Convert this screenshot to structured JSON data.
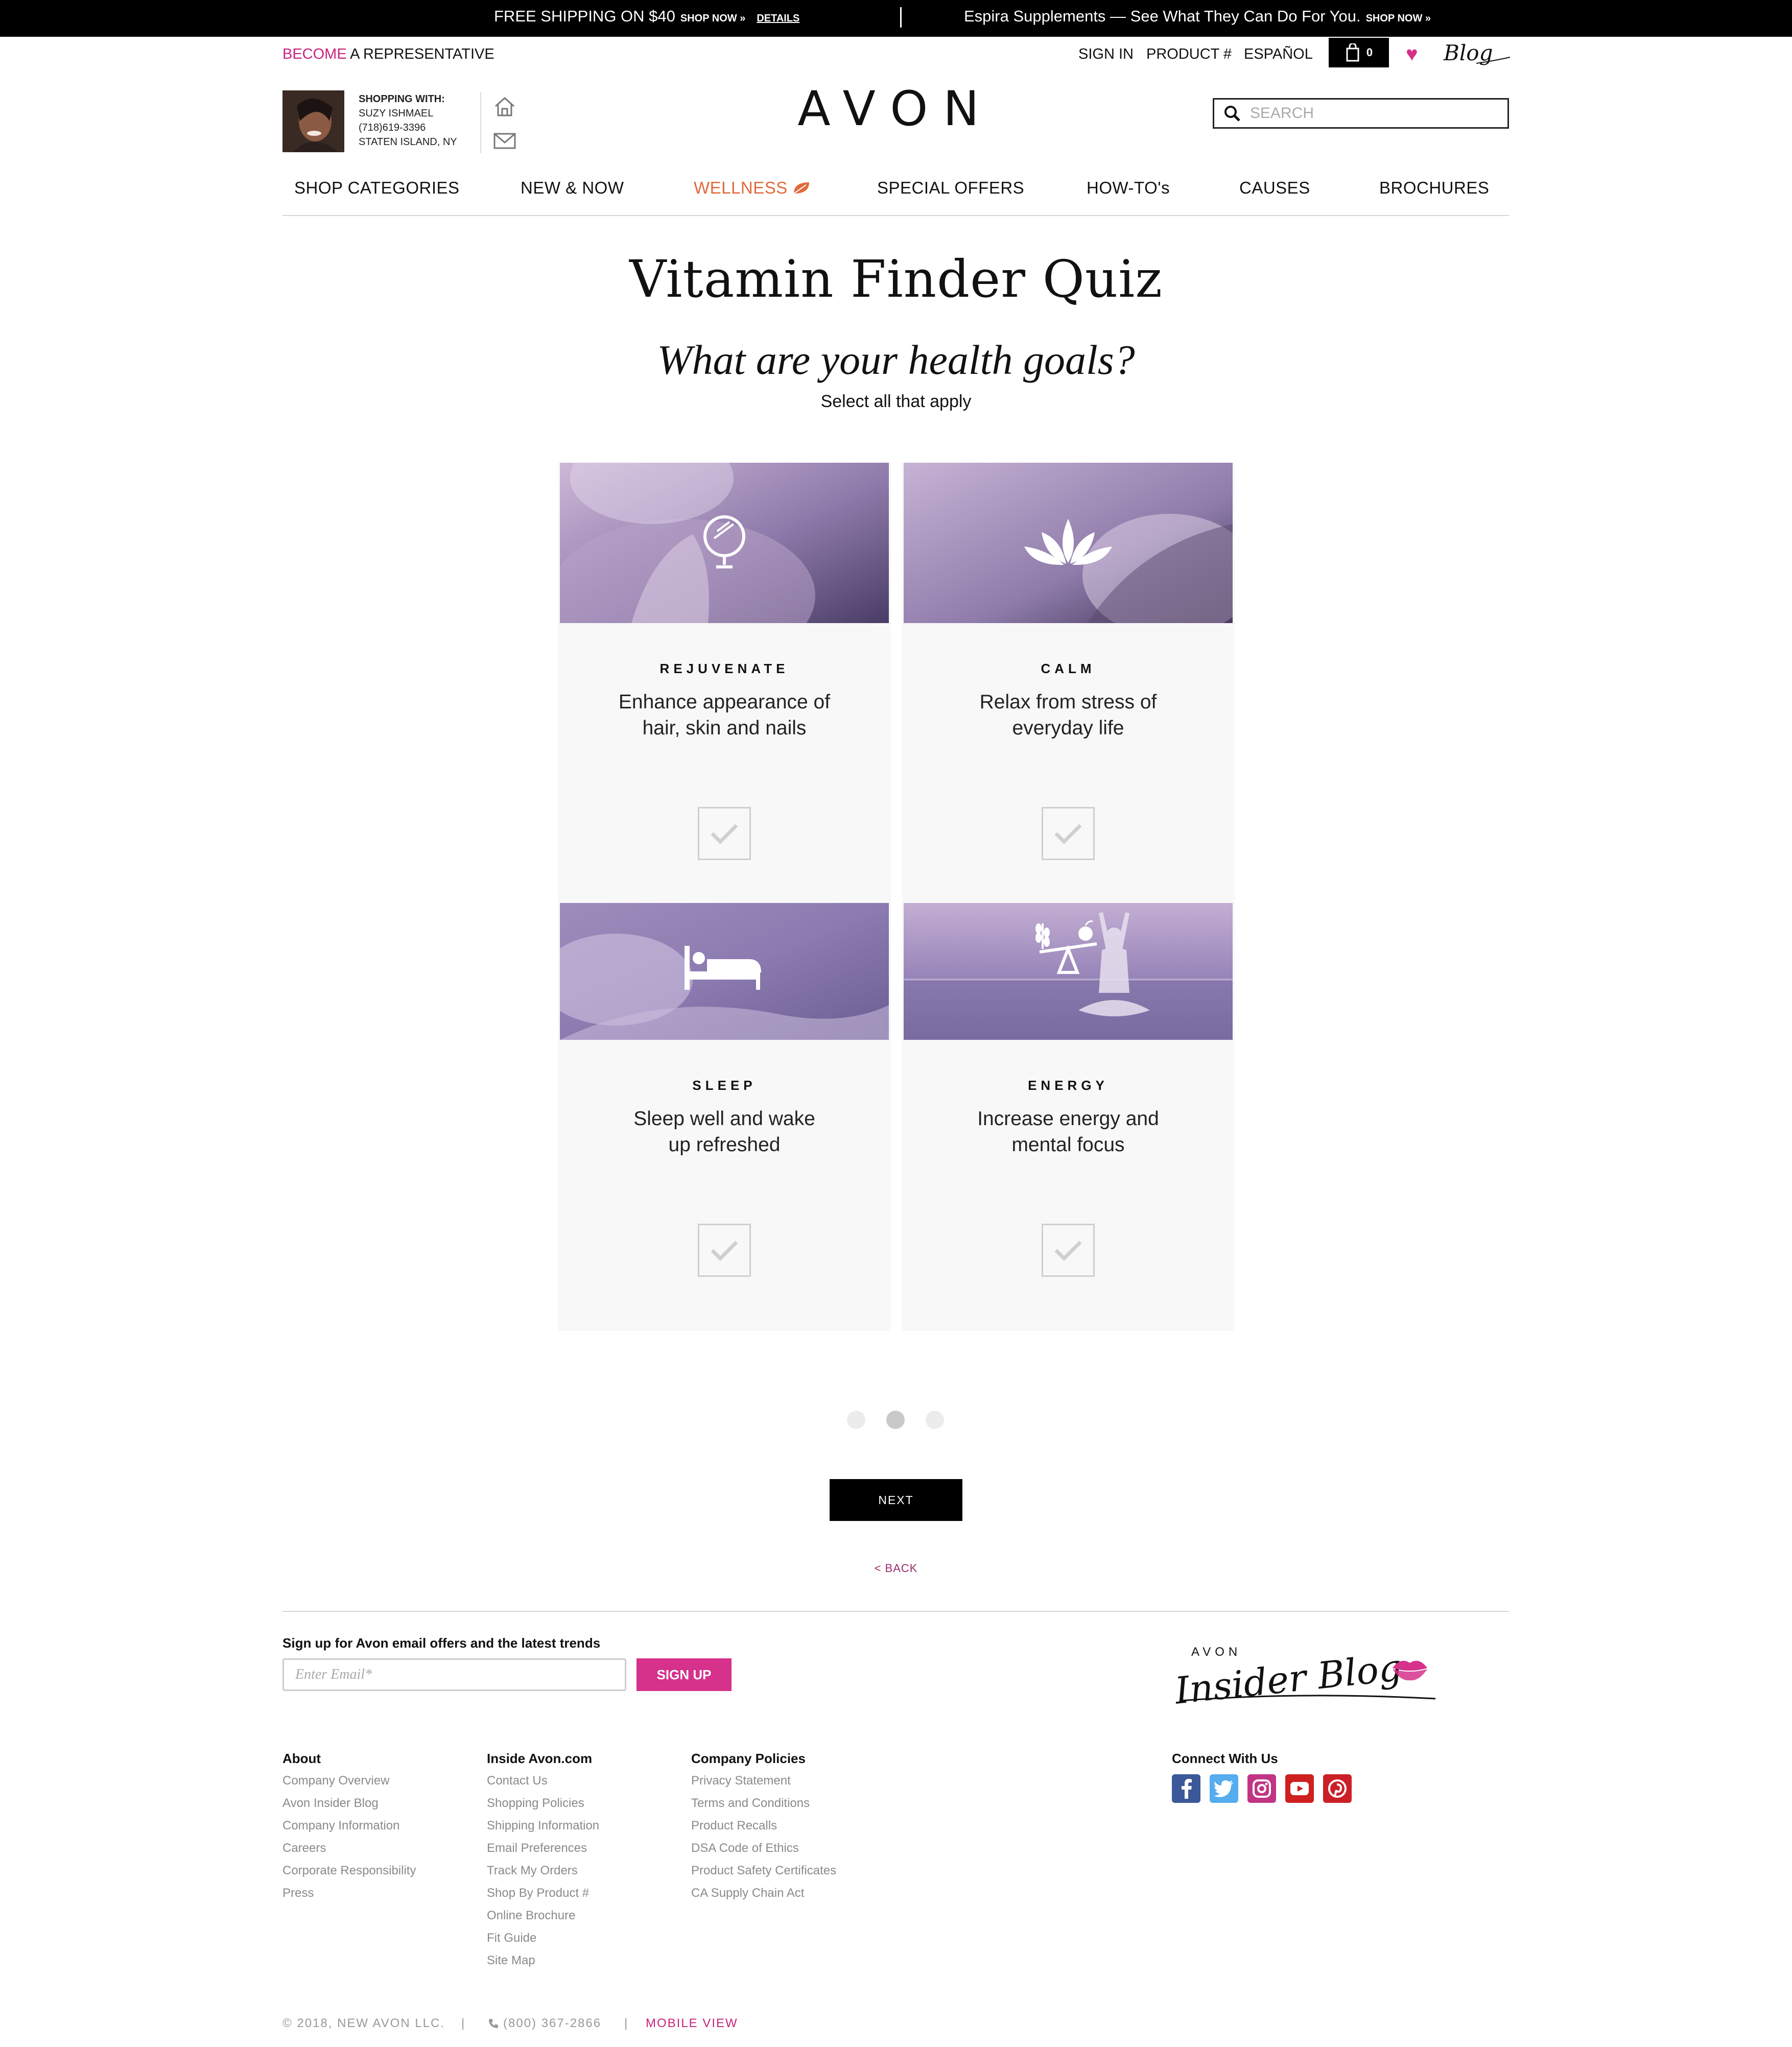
{
  "promo": {
    "left_main": "FREE SHIPPING ON $40",
    "left_cta": "SHOP NOW »",
    "left_link": "DETAILS",
    "right_main": "Espira Supplements — See What They Can Do For You.",
    "right_cta": "SHOP NOW »"
  },
  "utility": {
    "become_pink": "BECOME",
    "become_rest": " A REPRESENTATIVE",
    "sign_in": "SIGN IN",
    "product": "PRODUCT #",
    "espanol": "ESPAÑOL",
    "bag_count": "0",
    "blog": "Blog"
  },
  "rep": {
    "heading": "SHOPPING WITH:",
    "name": "SUZY ISHMAEL",
    "phone": "(718)619-3396",
    "location": "STATEN ISLAND, NY"
  },
  "brand": {
    "logo": "AVON"
  },
  "search": {
    "placeholder": "SEARCH"
  },
  "nav": {
    "items": [
      "SHOP CATEGORIES",
      "NEW & NOW",
      "WELLNESS",
      "SPECIAL OFFERS",
      "HOW-TO's",
      "CAUSES",
      "BROCHURES"
    ]
  },
  "quiz": {
    "title": "Vitamin Finder Quiz",
    "question": "What are your health goals?",
    "hint": "Select all that apply",
    "cards": [
      {
        "label": "REJUVENATE",
        "desc_line1": "Enhance appearance of",
        "desc_line2": "hair, skin and nails",
        "icon": "mirror-icon"
      },
      {
        "label": "CALM",
        "desc_line1": "Relax from stress of",
        "desc_line2": "everyday life",
        "icon": "lotus-icon"
      },
      {
        "label": "SLEEP",
        "desc_line1": "Sleep well and wake",
        "desc_line2": "up refreshed",
        "icon": "bed-icon"
      },
      {
        "label": "ENERGY",
        "desc_line1": "Increase energy and",
        "desc_line2": "mental focus",
        "icon": "balance-icon"
      }
    ],
    "pagination": {
      "pages": 3,
      "current": 2
    },
    "next": "NEXT",
    "back": "< BACK"
  },
  "footer": {
    "signup_label": "Sign up for Avon email offers and the latest trends",
    "email_placeholder": "Enter Email*",
    "signup_btn": "SIGN UP",
    "insider_top": "AVON",
    "insider_script": "Insider Blog",
    "columns": [
      {
        "title": "About",
        "links": [
          "Company Overview",
          "Avon Insider Blog",
          "Company Information",
          "Careers",
          "Corporate Responsibility",
          "Press"
        ]
      },
      {
        "title": "Inside Avon.com",
        "links": [
          "Contact Us",
          "Shopping Policies",
          "Shipping Information",
          "Email Preferences",
          "Track My Orders",
          "Shop By Product #",
          "Online Brochure",
          "Fit Guide",
          "Site Map"
        ]
      },
      {
        "title": "Company Policies",
        "links": [
          "Privacy Statement",
          "Terms and Conditions",
          "Product Recalls",
          "DSA Code of Ethics",
          "Product Safety Certificates",
          "CA Supply Chain Act"
        ]
      }
    ],
    "connect": "Connect With Us",
    "social": [
      {
        "name": "facebook-icon",
        "color": "#3b5998"
      },
      {
        "name": "twitter-icon",
        "color": "#55acee"
      },
      {
        "name": "instagram-icon",
        "color": "#c13584"
      },
      {
        "name": "youtube-icon",
        "color": "#cd201f"
      },
      {
        "name": "pinterest-icon",
        "color": "#cb2027"
      }
    ],
    "copyright": "© 2018, NEW AVON LLC.",
    "phone": "(800) 367-2866",
    "mobile": "MOBILE VIEW"
  },
  "colors": {
    "accent_pink": "#c8237d",
    "wellness_orange": "#e06a3a",
    "card_bg": "#f8f8f8",
    "image_purple": "#8a7aa8"
  }
}
